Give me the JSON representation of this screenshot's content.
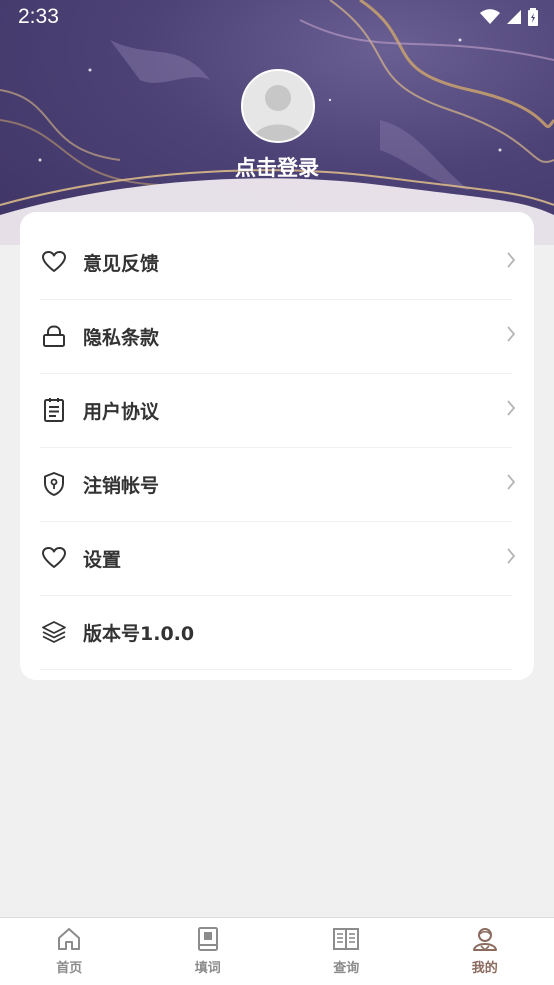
{
  "status_bar": {
    "time": "2:33"
  },
  "profile": {
    "login_label": "点击登录"
  },
  "menu": {
    "items": [
      {
        "label": "意见反馈",
        "icon": "heart-icon",
        "has_arrow": true
      },
      {
        "label": "隐私条款",
        "icon": "lock-icon",
        "has_arrow": true
      },
      {
        "label": "用户协议",
        "icon": "clipboard-icon",
        "has_arrow": true
      },
      {
        "label": "注销帐号",
        "icon": "shield-icon",
        "has_arrow": true
      },
      {
        "label": "设置",
        "icon": "heart-icon",
        "has_arrow": true
      },
      {
        "label": "版本号1.0.0",
        "icon": "layers-icon",
        "has_arrow": false
      }
    ]
  },
  "tabbar": {
    "tabs": [
      {
        "label": "首页",
        "icon": "home-icon",
        "active": false
      },
      {
        "label": "填词",
        "icon": "book-icon",
        "active": false
      },
      {
        "label": "查询",
        "icon": "open-book-icon",
        "active": false
      },
      {
        "label": "我的",
        "icon": "person-icon",
        "active": true
      }
    ]
  },
  "colors": {
    "header_bg": "#4d4276",
    "text_primary": "#333333",
    "tab_active": "#8a6b5d",
    "tab_inactive": "#8c8c8c",
    "page_bg": "#f0f0f0"
  }
}
